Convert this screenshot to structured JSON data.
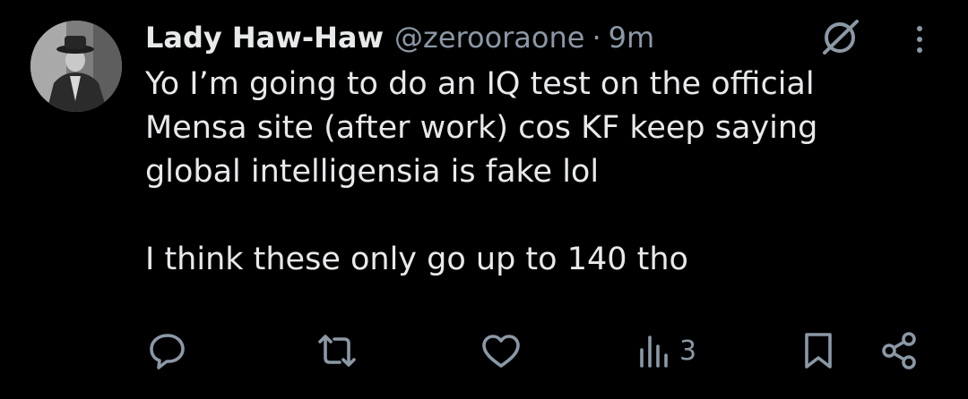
{
  "author": {
    "display_name": "Lady Haw-Haw",
    "handle": "@zerooraone",
    "separator": "·",
    "time": "9m"
  },
  "tweet": {
    "text": "Yo I’m going to do an IQ test on the official\nMensa site (after work) cos KF keep saying\nglobal intelligensia is fake lol\n\nI think these only go up to 140 tho"
  },
  "actions": {
    "views": "3",
    "icons": [
      "reply-icon",
      "retweet-icon",
      "like-icon",
      "views-icon",
      "bookmark-icon",
      "share-icon"
    ]
  },
  "colors": {
    "background": "#000000",
    "primary_text": "#e7e9ea",
    "secondary_text": "#8b98a5"
  }
}
